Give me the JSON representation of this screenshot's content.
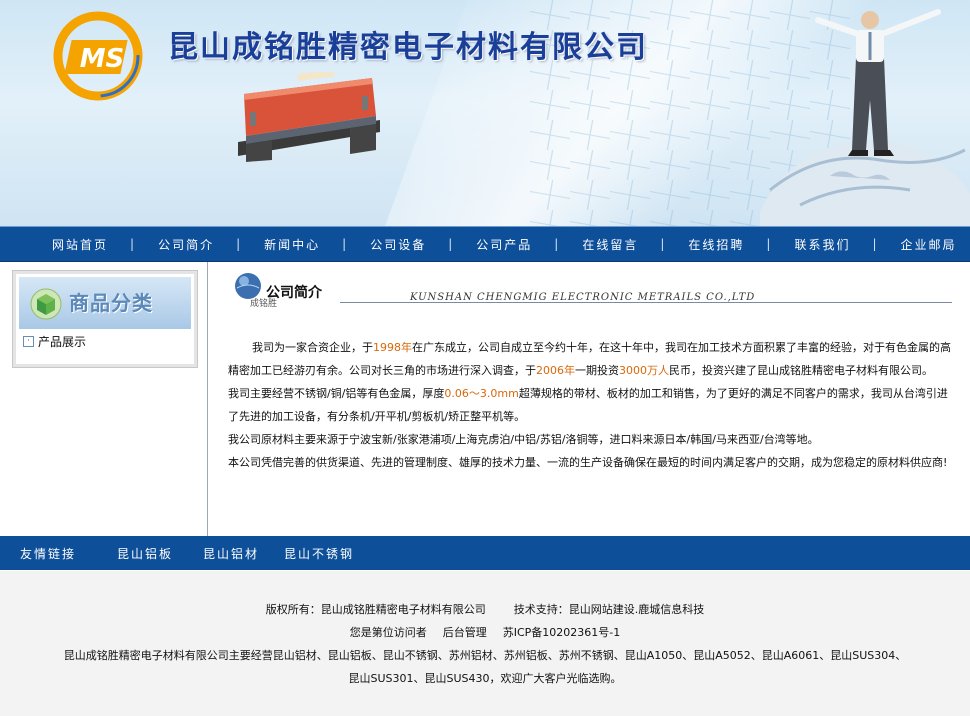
{
  "header": {
    "company_name": "昆山成铭胜精密电子材料有限公司",
    "logo_text": "MS"
  },
  "nav": {
    "items": [
      "网站首页",
      "公司简介",
      "新闻中心",
      "公司设备",
      "公司产品",
      "在线留言",
      "在线招聘",
      "联系我们",
      "企业邮局"
    ],
    "separator": "|"
  },
  "sidebar": {
    "title": "商品分类",
    "items": [
      {
        "label": "产品展示",
        "icon": "expand-box-icon"
      }
    ]
  },
  "section": {
    "title": "公司简介",
    "subtitle": "成铭胜",
    "english": "KUNSHAN CHENGMIG ELECTRONIC METRAILS CO.,LTD"
  },
  "intro": {
    "p1_a": "我司为一家合资企业，于",
    "p1_year": "1998年",
    "p1_b": "在广东成立，公司自成立至今约十年，在这十年中，我司在加工技术方面积累了丰富的经验，对于有色金属的高精密加工已经游刃有余。公司对长三角的市场进行深入调查，于",
    "p1_year2": "2006年",
    "p1_c": "一期投资",
    "p1_amount": "3000万人",
    "p1_d": "民币，投资兴建了昆山成铭胜精密电子材料有限公司。",
    "p2_a": "我司主要经营不锈钢/铜/铝等有色金属，厚度",
    "p2_thick": "0.06～3.0mm",
    "p2_b": "超薄规格的带材、板材的加工和销售，为了更好的满足不同客户的需求，我司从台湾引进了先进的加工设备，有分条机/开平机/剪板机/矫正整平机等。",
    "p3": "我公司原材料主要来源于宁波宝新/张家港浦项/上海克虏泊/中铝/苏铝/洛铜等，进口料来源日本/韩国/马来西亚/台湾等地。",
    "p4": "本公司凭借完善的供货渠道、先进的管理制度、雄厚的技术力量、一流的生产设备确保在最短的时间内满足客户的交期，成为您稳定的原材料供应商!"
  },
  "links": {
    "title": "友情链接",
    "items": [
      "昆山铝板",
      "昆山铝材",
      "昆山不锈钢"
    ]
  },
  "footer": {
    "copyright": "版权所有：昆山成铭胜精密电子材料有限公司",
    "support": "技术支持：昆山网站建设.鹿城信息科技",
    "visitor": "您是第位访问者",
    "admin": "后台管理",
    "icp": "苏ICP备10202361号-1",
    "desc1": "昆山成铭胜精密电子材料有限公司主要经营昆山铝材、昆山铝板、昆山不锈钢、苏州铝材、苏州铝板、苏州不锈钢、昆山A1050、昆山A5052、昆山A6061、昆山SUS304、",
    "desc2": "昆山SUS301、昆山SUS430，欢迎广大客户光临选购。"
  },
  "colors": {
    "nav_bg": "#0e4f9a",
    "title_blue": "#1a3f99",
    "highlight": "#d9680a",
    "footer_bg": "#f3f3f3"
  }
}
